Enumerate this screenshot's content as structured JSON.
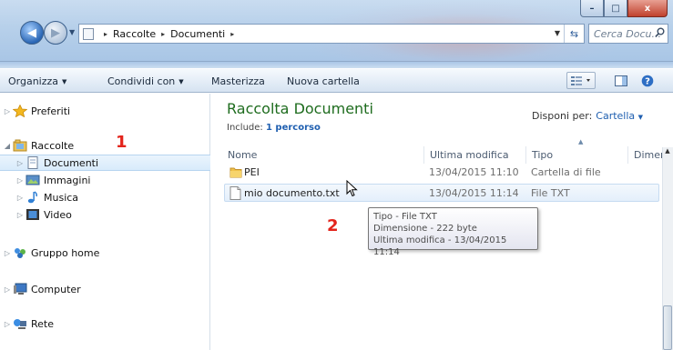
{
  "window": {
    "controls": {
      "minimize": "–",
      "maximize": "□",
      "close": "x"
    }
  },
  "nav": {
    "back_icon": "arrow-left-icon",
    "forward_icon": "arrow-right-icon"
  },
  "address": {
    "crumbs": [
      "Raccolte",
      "Documenti"
    ],
    "separator": "▸"
  },
  "search": {
    "placeholder": "Cerca Docu..."
  },
  "toolbar": {
    "organize": "Organizza",
    "share": "Condividi con",
    "burn": "Masterizza",
    "new_folder": "Nuova cartella"
  },
  "sidebar": {
    "items": [
      {
        "label": "Preferiti",
        "icon": "star-icon"
      },
      {
        "label": "Raccolte",
        "icon": "libraries-icon"
      },
      {
        "label": "Documenti",
        "icon": "documents-icon"
      },
      {
        "label": "Immagini",
        "icon": "pictures-icon"
      },
      {
        "label": "Musica",
        "icon": "music-icon"
      },
      {
        "label": "Video",
        "icon": "video-icon"
      },
      {
        "label": "Gruppo home",
        "icon": "homegroup-icon"
      },
      {
        "label": "Computer",
        "icon": "computer-icon"
      },
      {
        "label": "Rete",
        "icon": "network-icon"
      }
    ]
  },
  "annotations": {
    "one": "1",
    "two": "2"
  },
  "library": {
    "title": "Raccolta Documenti",
    "include_prefix": "Include:",
    "include_link": "1 percorso",
    "arrange_label": "Disponi per:",
    "arrange_value": "Cartella"
  },
  "columns": [
    "Nome",
    "Ultima modifica",
    "Tipo",
    "Dimer"
  ],
  "files": [
    {
      "name": "PEI",
      "modified": "13/04/2015 11:10",
      "type": "Cartella di file",
      "icon": "folder-icon"
    },
    {
      "name": "mio documento.txt",
      "modified": "13/04/2015 11:14",
      "type": "File TXT",
      "icon": "text-file-icon"
    }
  ],
  "tooltip": {
    "line1": "Tipo - File TXT",
    "line2": "Dimensione - 222 byte",
    "line3": "Ultima modifica - 13/04/2015 11:14"
  },
  "colors": {
    "library_title": "#1e6c1e",
    "link": "#1f5fb0",
    "annotation": "#e3241b"
  }
}
